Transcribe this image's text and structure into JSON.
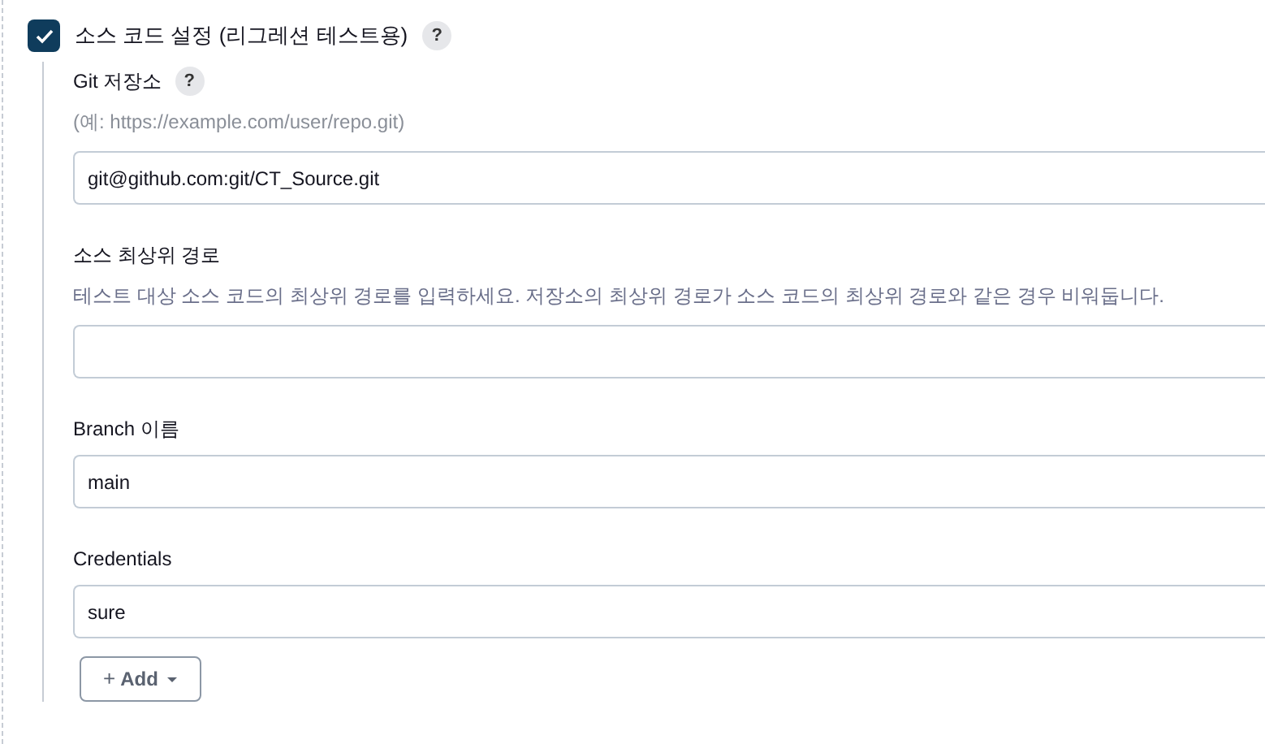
{
  "section": {
    "title": "소스 코드 설정 (리그레션 테스트용)",
    "checked": true,
    "help": "?"
  },
  "fields": [
    {
      "label": "Git 저장소",
      "help": "?",
      "hint": "(예: https://example.com/user/repo.git)",
      "value": "git@github.com:git/CT_Source.git"
    },
    {
      "label": "소스 최상위 경로",
      "description": "테스트 대상 소스 코드의 최상위 경로를 입력하세요. 저장소의 최상위 경로가 소스 코드의 최상위 경로와 같은 경우 비워둡니다."
    },
    {
      "label": "Branch 이름",
      "value": "main"
    },
    {
      "label": "Credentials",
      "value": "sure"
    }
  ],
  "add_button": {
    "plus": "+",
    "label": "Add"
  }
}
